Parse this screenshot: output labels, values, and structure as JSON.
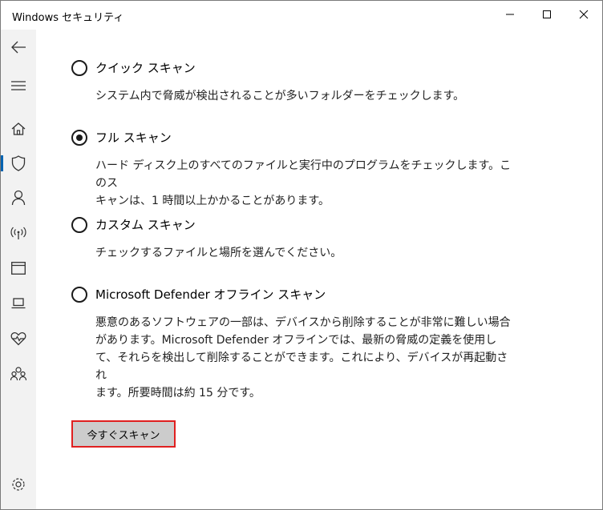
{
  "window": {
    "title": "Windows セキュリティ"
  },
  "sidebar": {
    "items": [
      {
        "name": "back-arrow-icon"
      },
      {
        "name": "hamburger-menu-icon"
      },
      {
        "name": "home-icon"
      },
      {
        "name": "shield-icon",
        "selected": true
      },
      {
        "name": "person-icon"
      },
      {
        "name": "wireless-icon"
      },
      {
        "name": "app-browser-icon"
      },
      {
        "name": "laptop-icon"
      },
      {
        "name": "heart-health-icon"
      },
      {
        "name": "family-icon"
      },
      {
        "name": "settings-gear-icon"
      }
    ]
  },
  "scan_options": [
    {
      "label": "クイック スキャン",
      "description": "システム内で脅威が検出されることが多いフォルダーをチェックします。",
      "checked": false
    },
    {
      "label": "フル スキャン",
      "description": "ハード ディスク上のすべてのファイルと実行中のプログラムをチェックします。このス\nキャンは、1 時間以上かかることがあります。",
      "checked": true
    },
    {
      "label": "カスタム スキャン",
      "description": "チェックするファイルと場所を選んでください。",
      "checked": false
    },
    {
      "label": "Microsoft Defender オフライン スキャン",
      "description": "悪意のあるソフトウェアの一部は、デバイスから削除することが非常に難しい場合\nがあります。Microsoft Defender オフラインでは、最新の脅威の定義を使用し\nて、それらを検出して削除することができます。これにより、デバイスが再起動され\nます。所要時間は約 15 分です。",
      "checked": false
    }
  ],
  "scan_button": {
    "label": "今すぐスキャン"
  },
  "colors": {
    "accent": "#0063b1",
    "highlight_border": "#e02020",
    "sidebar_bg": "#f2f2f2",
    "button_bg": "#cccccc"
  }
}
